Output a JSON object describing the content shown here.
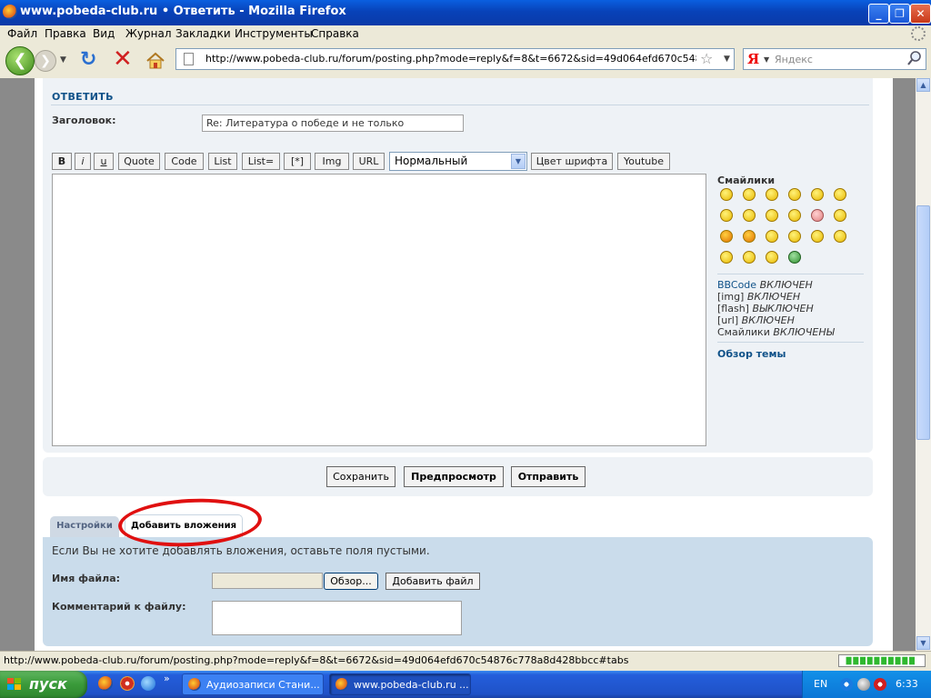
{
  "window": {
    "title": "www.pobeda-club.ru • Ответить - Mozilla Firefox",
    "min_label": "_",
    "max_label": "❐",
    "close_label": "✕"
  },
  "menu": {
    "items": [
      "Файл",
      "Правка",
      "Вид",
      "Журнал",
      "Закладки",
      "Инструменты",
      "Справка"
    ]
  },
  "nav": {
    "url": "http://www.pobeda-club.ru/forum/posting.php?mode=reply&f=8&t=6672&sid=49d064efd670c54876c778a8d4",
    "search_placeholder": "Яндекс",
    "yandex_letter": "Я"
  },
  "post": {
    "heading": "ОТВЕТИТЬ",
    "subject_label": "Заголовок:",
    "subject_value": "Re: Литература о победе и не только",
    "bbcode_buttons": [
      "B",
      "i",
      "u",
      "Quote",
      "Code",
      "List",
      "List=",
      "[*]",
      "Img",
      "URL"
    ],
    "font_size_value": "Нормальный",
    "extra_buttons": [
      "Цвет шрифта",
      "Youtube"
    ]
  },
  "sidebar": {
    "smilies_title": "Смайлики",
    "status": [
      {
        "name": "BBCode",
        "state": "ВКЛЮЧЕН"
      },
      {
        "name": "[img]",
        "state": "ВКЛЮЧЕН"
      },
      {
        "name": "[flash]",
        "state": "ВЫКЛЮЧЕН"
      },
      {
        "name": "[url]",
        "state": "ВКЛЮЧЕН"
      },
      {
        "name": "Смайлики",
        "state": "ВКЛЮЧЕНЫ"
      }
    ],
    "topic_review": "Обзор темы"
  },
  "submit": {
    "save": "Сохранить",
    "preview": "Предпросмотр",
    "send": "Отправить"
  },
  "tabs": {
    "options": "Настройки",
    "attachments": "Добавить вложения"
  },
  "attach": {
    "hint": "Если Вы не хотите добавлять вложения, оставьте поля пустыми.",
    "filename_label": "Имя файла:",
    "browse": "Обзор...",
    "add_file": "Добавить файл",
    "comment_label": "Комментарий к файлу:"
  },
  "statusbar": {
    "text": "http://www.pobeda-club.ru/forum/posting.php?mode=reply&f=8&t=6672&sid=49d064efd670c54876c778a8d428bbcc#tabs"
  },
  "taskbar": {
    "start": "пуск",
    "more": "»",
    "tasks": [
      "Аудиозаписи Стани...",
      "www.pobeda-club.ru ..."
    ],
    "lang": "EN",
    "clock": "6:33"
  },
  "colors": {
    "accent": "#105289",
    "highlight_circle": "#e01010",
    "attach_panel": "#cadceb"
  }
}
